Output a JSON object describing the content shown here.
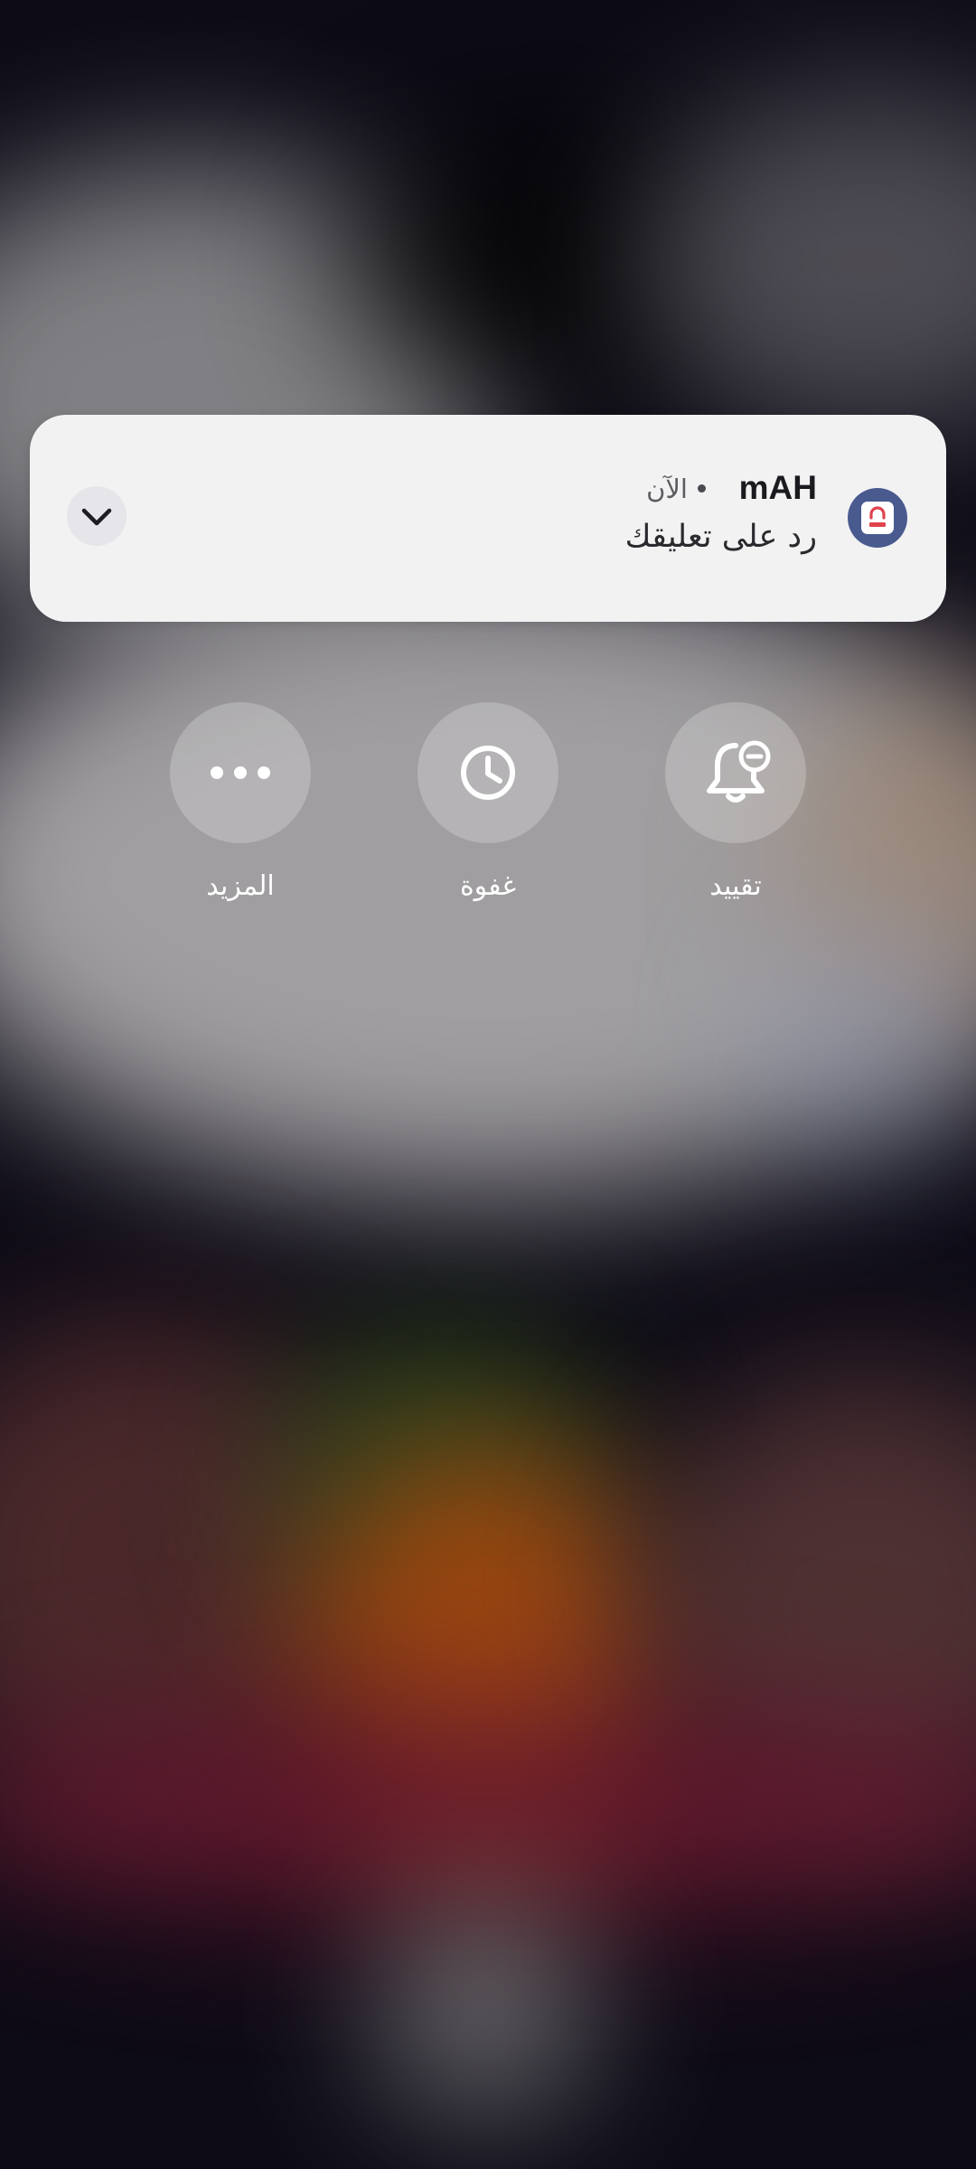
{
  "notification": {
    "app_name": "mAH",
    "time": "الآن",
    "message": "رد على تعليقك",
    "app_icon": "mah-app-icon",
    "expand_icon": "chevron-down-icon"
  },
  "actions": [
    {
      "label": "المزيد",
      "icon": "more-dots-icon"
    },
    {
      "label": "غفوة",
      "icon": "clock-icon"
    },
    {
      "label": "تقييد",
      "icon": "bell-minus-icon"
    }
  ],
  "colors": {
    "card_background": "#f2f2f3",
    "app_icon_background": "#495a8f",
    "app_icon_accent": "#e0444e",
    "action_circle": "rgba(255,255,255,0.22)",
    "action_label": "#ffffff"
  }
}
